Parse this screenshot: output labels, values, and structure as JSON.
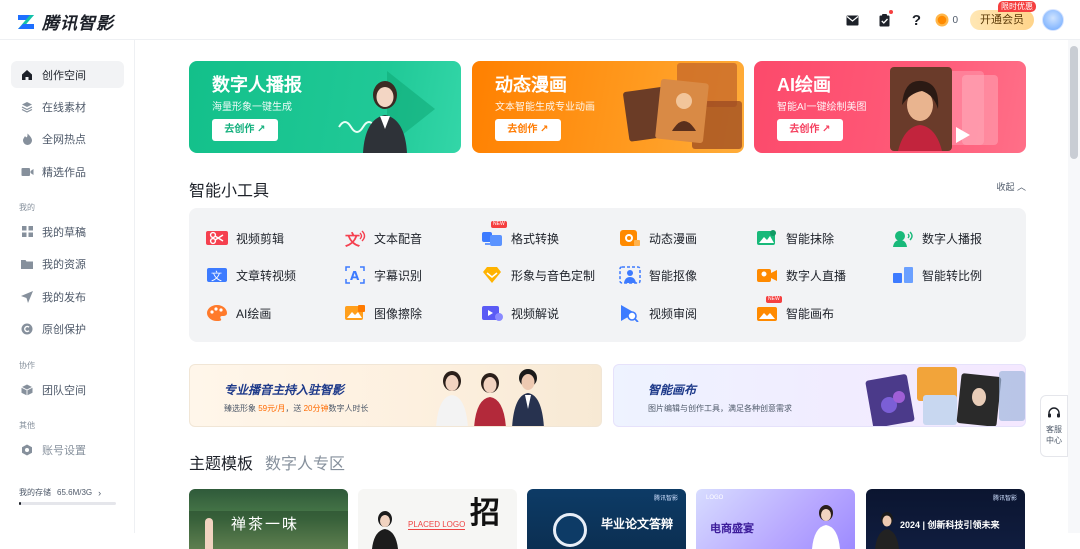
{
  "brand": {
    "name": "腾讯智影"
  },
  "topbar": {
    "coin_count": "0",
    "vip_label": "开通会员",
    "vip_badge": "限时优惠"
  },
  "sidebar": {
    "items": [
      {
        "label": "创作空间",
        "icon": "home-icon",
        "active": true
      },
      {
        "label": "在线素材",
        "icon": "layers-icon"
      },
      {
        "label": "全网热点",
        "icon": "fire-icon"
      },
      {
        "label": "精选作品",
        "icon": "video-icon"
      }
    ],
    "mine_group": "我的",
    "mine_items": [
      {
        "label": "我的草稿",
        "icon": "grid-icon"
      },
      {
        "label": "我的资源",
        "icon": "folder-icon"
      },
      {
        "label": "我的发布",
        "icon": "send-icon"
      },
      {
        "label": "原创保护",
        "icon": "copyright-icon"
      }
    ],
    "collab_group": "协作",
    "collab_items": [
      {
        "label": "团队空间",
        "icon": "cube-icon"
      }
    ],
    "other_group": "其他",
    "other_items": [
      {
        "label": "账号设置",
        "icon": "hexagon-icon"
      }
    ],
    "storage_label": "我的存储",
    "storage_value": "65.6M/3G",
    "storage_used_fraction": 0.021
  },
  "banners": [
    {
      "title": "数字人播报",
      "subtitle": "海量形象一键生成",
      "button": "去创作 ↗",
      "color": "#1bc286"
    },
    {
      "title": "动态漫画",
      "subtitle": "文本智能生成专业动画",
      "button": "去创作 ↗",
      "color": "#ff8a00"
    },
    {
      "title": "AI绘画",
      "subtitle": "智能AI一键绘制美图",
      "button": "去创作 ↗",
      "color": "#fc4b6c"
    }
  ],
  "tools_section": {
    "title": "智能小工具",
    "collapse": "收起 ︿"
  },
  "tools": [
    [
      {
        "label": "视频剪辑",
        "icon": "scissors-icon"
      },
      {
        "label": "文本配音",
        "icon": "text-voice-icon"
      },
      {
        "label": "格式转换",
        "icon": "convert-icon",
        "new": true
      },
      {
        "label": "动态漫画",
        "icon": "comic-icon"
      },
      {
        "label": "智能抹除",
        "icon": "erase-icon"
      },
      {
        "label": "数字人播报",
        "icon": "avatar-speak-icon"
      }
    ],
    [
      {
        "label": "文章转视频",
        "icon": "article-video-icon"
      },
      {
        "label": "字幕识别",
        "icon": "subtitle-icon"
      },
      {
        "label": "形象与音色定制",
        "icon": "diamond-icon"
      },
      {
        "label": "智能抠像",
        "icon": "cutout-icon"
      },
      {
        "label": "数字人直播",
        "icon": "live-icon"
      },
      {
        "label": "智能转比例",
        "icon": "ratio-icon"
      }
    ],
    [
      {
        "label": "AI绘画",
        "icon": "palette-icon"
      },
      {
        "label": "图像擦除",
        "icon": "image-erase-icon"
      },
      {
        "label": "视频解说",
        "icon": "narrate-icon"
      },
      {
        "label": "视频审阅",
        "icon": "review-icon"
      },
      {
        "label": "智能画布",
        "icon": "canvas-icon",
        "new": true
      }
    ]
  ],
  "new_badge": "NEW",
  "promos": [
    {
      "title": "专业播音主持入驻智影",
      "sub_a": "臻选形象",
      "sub_price": "59元/月",
      "sub_b": "，送",
      "sub_time": "20分钟",
      "sub_c": "数字人时长"
    },
    {
      "title": "智能画布",
      "subtitle": "图片编辑与创作工具，满足各种创意需求"
    }
  ],
  "template_tabs": [
    "主题模板",
    "数字人专区"
  ],
  "templates": [
    {
      "text": "禅茶一味"
    },
    {
      "text": "招",
      "logo": "PLACED LOGO"
    },
    {
      "text": "毕业论文答辩",
      "brand": "腾讯智影"
    },
    {
      "text": "电商盛宴",
      "logo": "LOGO"
    },
    {
      "text": "2024 | 创新科技引领未来",
      "brand": "腾讯智影"
    }
  ],
  "service": {
    "label": "客服\n中心"
  }
}
